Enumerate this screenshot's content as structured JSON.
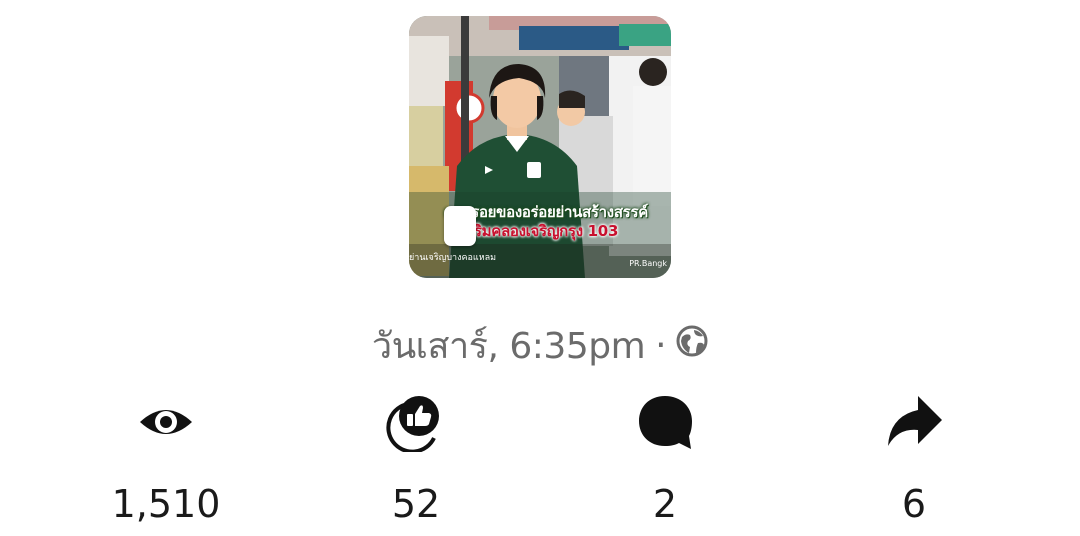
{
  "post": {
    "thumbnail": {
      "caption_line1": "ตามรอยของอร่อยย่านสร้างสรรค์",
      "caption_line2": "ริมคลองเจริญกรุง 103",
      "footer_left": "ย่านเจริญบางคอแหลม",
      "footer_right": "PR.Bangk",
      "icon": "post-video-thumbnail"
    },
    "timestamp": "วันเสาร์, 6:35pm",
    "separator": "·",
    "audience_icon": "globe-icon",
    "stats": {
      "views": {
        "count": "1,510",
        "icon": "eye-icon"
      },
      "likes": {
        "count": "52",
        "icon": "thumbs-up-icon"
      },
      "comments": {
        "count": "2",
        "icon": "comment-bubble-icon"
      },
      "shares": {
        "count": "6",
        "icon": "share-arrow-icon"
      }
    }
  },
  "colors": {
    "text_primary": "#1a1a1a",
    "text_secondary": "#6b6b6b",
    "background": "#ffffff"
  }
}
